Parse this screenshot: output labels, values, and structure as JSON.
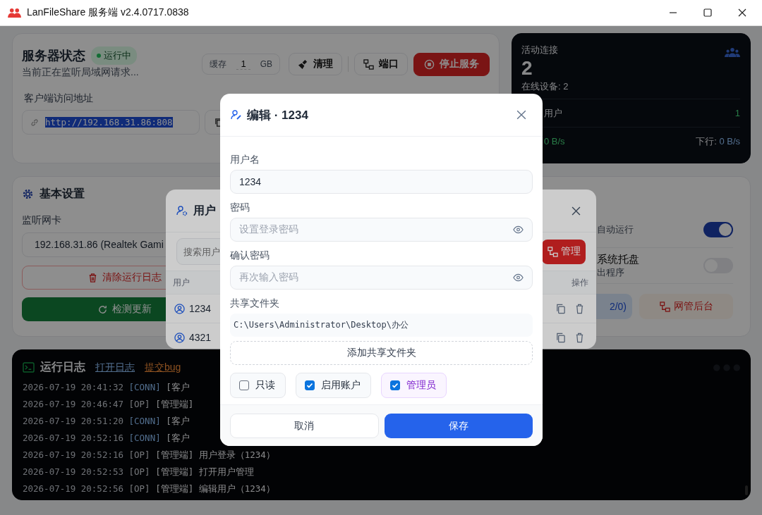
{
  "window": {
    "title": "LanFileShare 服务端 v2.4.0717.0838"
  },
  "server_status": {
    "title": "服务器状态",
    "status_badge": "运行中",
    "subtitle": "当前正在监听局域网请求...",
    "cache": {
      "label": "缓存",
      "value": "1",
      "unit": "GB"
    },
    "buttons": [
      {
        "label": "清理",
        "kind": "clean"
      },
      {
        "label": "端口",
        "kind": "port"
      },
      {
        "label": "停止服务",
        "kind": "stop"
      }
    ],
    "address_label": "客户端访问地址",
    "address": "http://192.168.31.86:808"
  },
  "connections": {
    "title": "活动连接",
    "count": "2",
    "devices": "在线设备: 2",
    "online_label": "用户",
    "online_value": "1",
    "upload": "0 B/s",
    "download_label": "下行:",
    "download": "0 B/s"
  },
  "basic_settings": {
    "title": "基本设置",
    "nic_label": "监听网卡",
    "nic_value": "192.168.31.86 (Realtek Gami",
    "clear_log": "清除运行日志",
    "check_update": "检测更新"
  },
  "options": {
    "toggles": [
      {
        "desc": "自动运行",
        "on": true
      },
      {
        "title": "系统托盘",
        "desc": "出程序",
        "on": false
      }
    ],
    "buttons": [
      {
        "label": "2/0)",
        "kind": "info"
      },
      {
        "label": "网管后台",
        "kind": "admin"
      }
    ]
  },
  "log": {
    "title": "运行日志",
    "links": [
      {
        "label": "打开日志",
        "kind": "open"
      },
      {
        "label": "提交bug",
        "kind": "bug"
      }
    ],
    "lines": [
      {
        "time": "2026-07-19 20:41:32",
        "tag": "[CONN]",
        "kind": "conn",
        "text": "[客户"
      },
      {
        "time": "2026-07-19 20:46:47",
        "tag": "[OP]",
        "kind": "op",
        "text": "[管理端]"
      },
      {
        "time": "2026-07-19 20:51:20",
        "tag": "[CONN]",
        "kind": "conn",
        "text": "[客户"
      },
      {
        "time": "2026-07-19 20:52:16",
        "tag": "[CONN]",
        "kind": "conn",
        "text": "[客户"
      },
      {
        "time": "2026-07-19 20:52:16",
        "tag": "[OP]",
        "kind": "op",
        "text": "[管理端] 用户登录（1234）"
      },
      {
        "time": "2026-07-19 20:52:53",
        "tag": "[OP]",
        "kind": "op",
        "text": "[管理端] 打开用户管理"
      },
      {
        "time": "2026-07-19 20:52:56",
        "tag": "[OP]",
        "kind": "op",
        "text": "[管理端] 编辑用户（1234）"
      }
    ]
  },
  "user_dialog": {
    "title": "用户",
    "search_placeholder": "搜索用户",
    "manage_button": "管理",
    "columns": [
      "用户",
      "操作"
    ],
    "users": [
      {
        "name": "1234"
      },
      {
        "name": "4321"
      }
    ]
  },
  "edit_dialog": {
    "title": "编辑 · 1234",
    "fields": [
      {
        "label": "用户名",
        "value": "1234",
        "kind": "text"
      },
      {
        "label": "密码",
        "placeholder": "设置登录密码",
        "kind": "password"
      },
      {
        "label": "确认密码",
        "placeholder": "再次输入密码",
        "kind": "password"
      }
    ],
    "folders_label": "共享文件夹",
    "folders": [
      "C:\\Users\\Administrator\\Desktop\\办公"
    ],
    "add_folder": "添加共享文件夹",
    "flags": [
      {
        "label": "只读",
        "checked": false,
        "kind": "plain"
      },
      {
        "label": "启用账户",
        "checked": true,
        "kind": "plain"
      },
      {
        "label": "管理员",
        "checked": true,
        "kind": "admin"
      }
    ],
    "cancel": "取消",
    "save": "保存"
  }
}
